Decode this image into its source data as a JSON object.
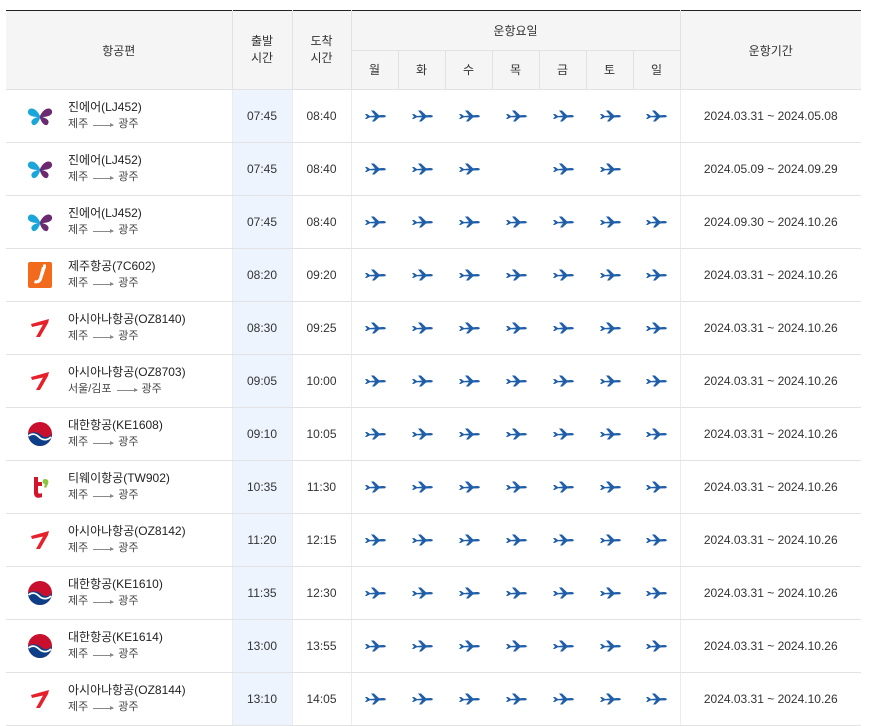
{
  "header": {
    "flight": "항공편",
    "departure": "출발\n시간",
    "arrival": "도착\n시간",
    "days_group": "운항요일",
    "period": "운항기간",
    "days": [
      "월",
      "화",
      "수",
      "목",
      "금",
      "토",
      "일"
    ]
  },
  "colors": {
    "plane_icon": "#1f5ea8",
    "dep_column_bg": "#eef4fd",
    "header_bg": "#f5f5f5"
  },
  "rows": [
    {
      "airline": "진에어(LJ452)",
      "logo": "jinair-logo",
      "from": "제주",
      "to": "광주",
      "dep": "07:45",
      "arr": "08:40",
      "days": [
        1,
        1,
        1,
        1,
        1,
        1,
        1
      ],
      "period": "2024.03.31 ~ 2024.05.08"
    },
    {
      "airline": "진에어(LJ452)",
      "logo": "jinair-logo",
      "from": "제주",
      "to": "광주",
      "dep": "07:45",
      "arr": "08:40",
      "days": [
        1,
        1,
        1,
        0,
        1,
        1,
        0
      ],
      "period": "2024.05.09 ~ 2024.09.29"
    },
    {
      "airline": "진에어(LJ452)",
      "logo": "jinair-logo",
      "from": "제주",
      "to": "광주",
      "dep": "07:45",
      "arr": "08:40",
      "days": [
        1,
        1,
        1,
        1,
        1,
        1,
        1
      ],
      "period": "2024.09.30 ~ 2024.10.26"
    },
    {
      "airline": "제주항공(7C602)",
      "logo": "jejuair-logo",
      "from": "제주",
      "to": "광주",
      "dep": "08:20",
      "arr": "09:20",
      "days": [
        1,
        1,
        1,
        1,
        1,
        1,
        1
      ],
      "period": "2024.03.31 ~ 2024.10.26"
    },
    {
      "airline": "아시아나항공(OZ8140)",
      "logo": "asiana-logo",
      "from": "제주",
      "to": "광주",
      "dep": "08:30",
      "arr": "09:25",
      "days": [
        1,
        1,
        1,
        1,
        1,
        1,
        1
      ],
      "period": "2024.03.31 ~ 2024.10.26"
    },
    {
      "airline": "아시아나항공(OZ8703)",
      "logo": "asiana-logo",
      "from": "서울/김포",
      "to": "광주",
      "dep": "09:05",
      "arr": "10:00",
      "days": [
        1,
        1,
        1,
        1,
        1,
        1,
        1
      ],
      "period": "2024.03.31 ~ 2024.10.26"
    },
    {
      "airline": "대한항공(KE1608)",
      "logo": "koreanair-logo",
      "from": "제주",
      "to": "광주",
      "dep": "09:10",
      "arr": "10:05",
      "days": [
        1,
        1,
        1,
        1,
        1,
        1,
        1
      ],
      "period": "2024.03.31 ~ 2024.10.26"
    },
    {
      "airline": "티웨이항공(TW902)",
      "logo": "tway-logo",
      "from": "제주",
      "to": "광주",
      "dep": "10:35",
      "arr": "11:30",
      "days": [
        1,
        1,
        1,
        1,
        1,
        1,
        1
      ],
      "period": "2024.03.31 ~ 2024.10.26"
    },
    {
      "airline": "아시아나항공(OZ8142)",
      "logo": "asiana-logo",
      "from": "제주",
      "to": "광주",
      "dep": "11:20",
      "arr": "12:15",
      "days": [
        1,
        1,
        1,
        1,
        1,
        1,
        1
      ],
      "period": "2024.03.31 ~ 2024.10.26"
    },
    {
      "airline": "대한항공(KE1610)",
      "logo": "koreanair-logo",
      "from": "제주",
      "to": "광주",
      "dep": "11:35",
      "arr": "12:30",
      "days": [
        1,
        1,
        1,
        1,
        1,
        1,
        1
      ],
      "period": "2024.03.31 ~ 2024.10.26"
    },
    {
      "airline": "대한항공(KE1614)",
      "logo": "koreanair-logo",
      "from": "제주",
      "to": "광주",
      "dep": "13:00",
      "arr": "13:55",
      "days": [
        1,
        1,
        1,
        1,
        1,
        1,
        1
      ],
      "period": "2024.03.31 ~ 2024.10.26"
    },
    {
      "airline": "아시아나항공(OZ8144)",
      "logo": "asiana-logo",
      "from": "제주",
      "to": "광주",
      "dep": "13:10",
      "arr": "14:05",
      "days": [
        1,
        1,
        1,
        1,
        1,
        1,
        1
      ],
      "period": "2024.03.31 ~ 2024.10.26"
    }
  ]
}
